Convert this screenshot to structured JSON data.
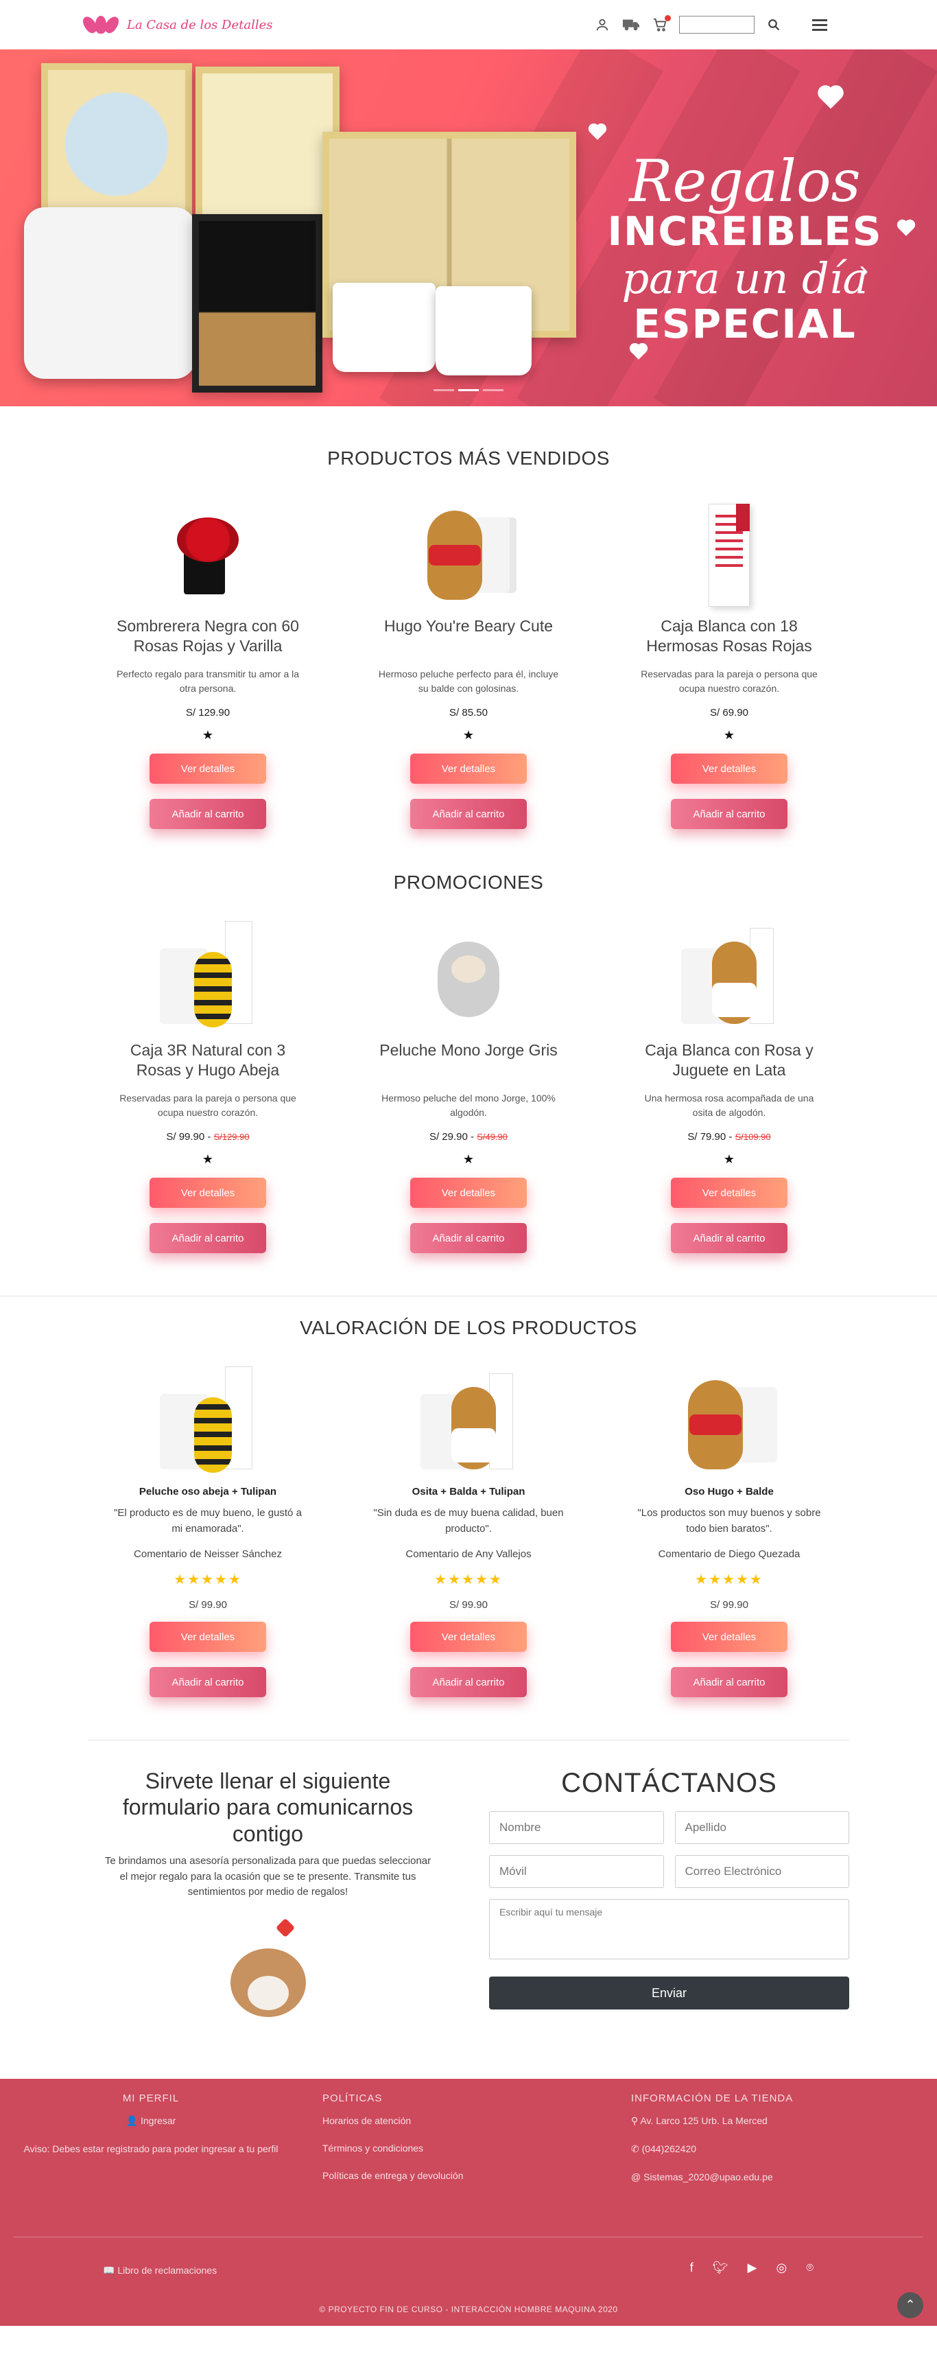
{
  "brand": {
    "name": "La Casa de los Detalles"
  },
  "nav": {
    "search_placeholder": ""
  },
  "hero": {
    "line1": "Regalos",
    "line2": "INCREIBLES",
    "line3": "para un día",
    "line4": "ESPECIAL"
  },
  "bestsellers": {
    "title": "PRODUCTOS MÁS VENDIDOS",
    "items": [
      {
        "name": "Sombrerera Negra con 60 Rosas Rojas y Varilla",
        "desc": "Perfecto regalo para transmitir tu amor a la otra persona.",
        "price": "S/ 129.90"
      },
      {
        "name": "Hugo You're Beary Cute",
        "desc": "Hermoso peluche perfecto para él, incluye su balde con golosinas.",
        "price": "S/ 85.50"
      },
      {
        "name": "Caja Blanca con 18 Hermosas Rosas Rojas",
        "desc": "Reservadas para la pareja o persona que ocupa nuestro corazón.",
        "price": "S/ 69.90"
      }
    ]
  },
  "promos": {
    "title": "PROMOCIONES",
    "items": [
      {
        "name": "Caja 3R Natural con 3 Rosas y Hugo Abeja",
        "desc": "Reservadas para la pareja o persona que ocupa nuestro corazón.",
        "price": "S/ 99.90 -",
        "old": "S/129.90"
      },
      {
        "name": "Peluche Mono Jorge Gris",
        "desc": "Hermoso peluche del mono Jorge, 100% algodón.",
        "price": "S/ 29.90 -",
        "old": "S/49.90"
      },
      {
        "name": "Caja Blanca con Rosa y Juguete en Lata",
        "desc": "Una hermosa rosa acompañada de una osita de algodón.",
        "price": "S/ 79.90 -",
        "old": "S/109.90"
      }
    ]
  },
  "reviews": {
    "title": "VALORACIÓN DE LOS PRODUCTOS",
    "items": [
      {
        "product": "Peluche oso abeja + Tulipan",
        "quote": "\"El producto es de muy bueno, le gustó a mi enamorada\".",
        "author": "Comentario de Neisser Sánchez",
        "rating": 5,
        "price": "S/ 99.90"
      },
      {
        "product": "Osita + Balda + Tulipan",
        "quote": "\"Sin duda es de muy buena calidad, buen producto\".",
        "author": "Comentario de Any Vallejos",
        "rating": 5,
        "price": "S/ 99.90"
      },
      {
        "product": "Oso Hugo + Balde",
        "quote": "\"Los productos son muy buenos y sobre todo bien baratos\".",
        "author": "Comentario de Diego Quezada",
        "rating": 5,
        "price": "S/ 99.90"
      }
    ]
  },
  "buttons": {
    "details": "Ver detalles",
    "add_cart": "Añadir al carrito"
  },
  "contact": {
    "left_title": "Sirvete llenar el siguiente formulario para comunicarnos contigo",
    "left_text": "Te brindamos una asesoría personalizada para que puedas seleccionar el mejor regalo para la ocasión que se te presente. Transmite tus sentimientos por medio de regalos!",
    "title": "CONTÁCTANOS",
    "name_ph": "Nombre",
    "surname_ph": "Apellido",
    "phone_ph": "Móvil",
    "email_ph": "Correo Electrónico",
    "msg_ph": "Escribir aquí tu mensaje",
    "send": "Enviar"
  },
  "footer": {
    "profile_title": "MI PERFIL",
    "login": "Ingresar",
    "notice": "Aviso: Debes estar registrado para poder ingresar a tu perfil",
    "policies_title": "POLÍTICAS",
    "policies": [
      "Horarios de atención",
      "Términos y condiciones",
      "Políticas de entrega y devolución"
    ],
    "store_title": "INFORMACIÓN DE LA TIENDA",
    "address": "Av. Larco 125 Urb. La Merced",
    "phone": "(044)262420",
    "email": "Sistemas_2020@upao.edu.pe",
    "complaints": "Libro de reclamaciones",
    "copyright": "© PROYECTO FIN DE CURSO - INTERACCIÓN HOMBRE MAQUINA 2020"
  },
  "colors": {
    "accent": "#ff5f6a",
    "footer": "#cc4a5c",
    "star": "#ffc107"
  }
}
